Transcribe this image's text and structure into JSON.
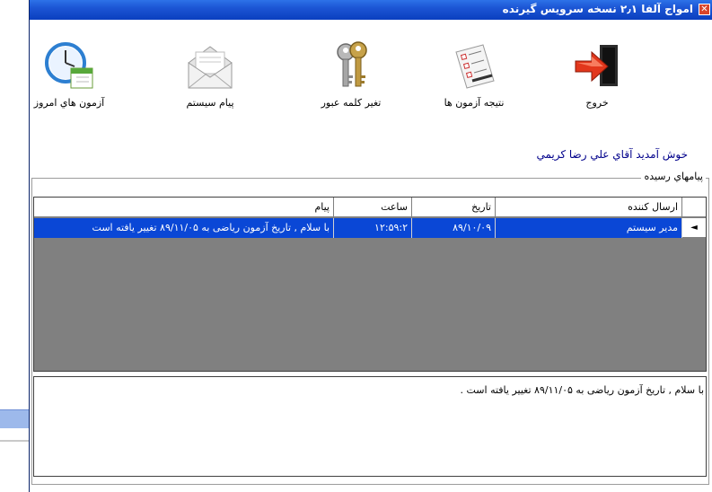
{
  "window": {
    "title": "امواج آلفا ۲٫۱ نسخه سرويس گيرنده",
    "close_glyph": "✕"
  },
  "toolbar": {
    "items": [
      {
        "label": "خروج",
        "icon": "exit-door-icon"
      },
      {
        "label": "نتيجه آزمون ها",
        "icon": "checklist-icon"
      },
      {
        "label": "تغير كلمه عبور",
        "icon": "keys-icon"
      },
      {
        "label": "پيام سيستم",
        "icon": "envelope-icon"
      },
      {
        "label": "آزمون هاي امروز",
        "icon": "clock-calendar-icon"
      }
    ]
  },
  "welcome_text": "خوش آمديد آقاي علي رضا كريمي",
  "messages": {
    "group_label": "پيامهاي رسيده",
    "columns": [
      "ارسال كننده",
      "تاريخ",
      "ساعت",
      "پيام"
    ],
    "rows": [
      {
        "sender": "مدير سيستم",
        "date": "۸۹/۱۰/۰۹",
        "time": "۱۲:۵۹:۲",
        "message": "با سلام , تاريخ آزمون رياضى به ۸۹/۱۱/۰۵ تغيير يافته است",
        "selected": true
      }
    ],
    "row_indicator": "◄",
    "detail_text": "با سلام , تاريخ آزمون رياضى به ۸۹/۱۱/۰۵ تغيير يافته است ."
  },
  "colors": {
    "titlebar": "#0a3fbf",
    "selection": "#0a47d6",
    "grid_background": "#808080",
    "welcome_text": "#00008b"
  }
}
